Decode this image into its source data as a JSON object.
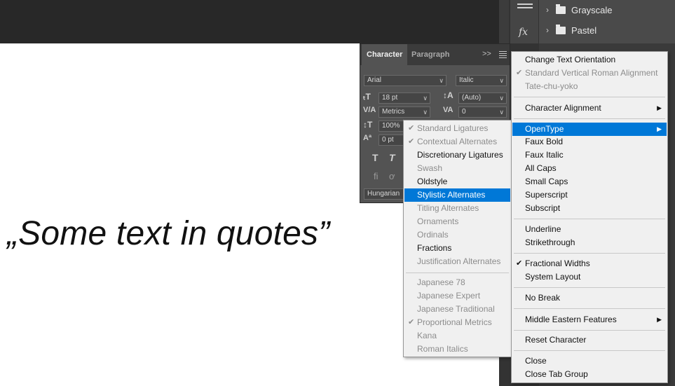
{
  "canvas": {
    "sample_text": "„Some text in quotes”"
  },
  "swatches": {
    "items": [
      "Grayscale",
      "Pastel"
    ]
  },
  "panel": {
    "tabs": [
      "Character",
      "Paragraph"
    ],
    "expand_glyph": ">>",
    "font_family": "Arial",
    "font_style": "Italic",
    "font_size": "18 pt",
    "leading": "(Auto)",
    "kerning": "Metrics",
    "tracking": "0",
    "vertical_scale": "100%",
    "baseline_shift": "0 pt",
    "language": "Hungarian"
  },
  "main_menu": {
    "items": [
      {
        "label": "Change Text Orientation",
        "checked": false,
        "disabled": false,
        "submenu": false
      },
      {
        "label": "Standard Vertical Roman Alignment",
        "checked": true,
        "disabled": true,
        "submenu": false
      },
      {
        "label": "Tate-chu-yoko",
        "checked": false,
        "disabled": true,
        "submenu": false
      },
      {
        "label": "Character Alignment",
        "checked": false,
        "disabled": false,
        "submenu": true
      },
      {
        "label": "OpenType",
        "checked": false,
        "disabled": false,
        "submenu": true,
        "selected": true
      },
      {
        "label": "Faux Bold",
        "checked": false,
        "disabled": false,
        "submenu": false
      },
      {
        "label": "Faux Italic",
        "checked": false,
        "disabled": false,
        "submenu": false
      },
      {
        "label": "All Caps",
        "checked": false,
        "disabled": false,
        "submenu": false
      },
      {
        "label": "Small Caps",
        "checked": false,
        "disabled": false,
        "submenu": false
      },
      {
        "label": "Superscript",
        "checked": false,
        "disabled": false,
        "submenu": false
      },
      {
        "label": "Subscript",
        "checked": false,
        "disabled": false,
        "submenu": false
      },
      {
        "label": "Underline",
        "checked": false,
        "disabled": false,
        "submenu": false
      },
      {
        "label": "Strikethrough",
        "checked": false,
        "disabled": false,
        "submenu": false
      },
      {
        "label": "Fractional Widths",
        "checked": true,
        "disabled": false,
        "submenu": false
      },
      {
        "label": "System Layout",
        "checked": false,
        "disabled": false,
        "submenu": false
      },
      {
        "label": "No Break",
        "checked": false,
        "disabled": false,
        "submenu": false
      },
      {
        "label": "Middle Eastern Features",
        "checked": false,
        "disabled": false,
        "submenu": true
      },
      {
        "label": "Reset Character",
        "checked": false,
        "disabled": false,
        "submenu": false
      },
      {
        "label": "Close",
        "checked": false,
        "disabled": false,
        "submenu": false
      },
      {
        "label": "Close Tab Group",
        "checked": false,
        "disabled": false,
        "submenu": false
      }
    ]
  },
  "opentype_menu": {
    "items": [
      {
        "label": "Standard Ligatures",
        "checked": true,
        "disabled": true
      },
      {
        "label": "Contextual Alternates",
        "checked": true,
        "disabled": true
      },
      {
        "label": "Discretionary Ligatures",
        "checked": false,
        "disabled": false
      },
      {
        "label": "Swash",
        "checked": false,
        "disabled": true
      },
      {
        "label": "Oldstyle",
        "checked": false,
        "disabled": false
      },
      {
        "label": "Stylistic Alternates",
        "checked": false,
        "disabled": false,
        "selected": true
      },
      {
        "label": "Titling Alternates",
        "checked": false,
        "disabled": true
      },
      {
        "label": "Ornaments",
        "checked": false,
        "disabled": true
      },
      {
        "label": "Ordinals",
        "checked": false,
        "disabled": true
      },
      {
        "label": "Fractions",
        "checked": false,
        "disabled": false
      },
      {
        "label": "Justification Alternates",
        "checked": false,
        "disabled": true
      },
      {
        "label": "Japanese 78",
        "checked": false,
        "disabled": true
      },
      {
        "label": "Japanese Expert",
        "checked": false,
        "disabled": true
      },
      {
        "label": "Japanese Traditional",
        "checked": false,
        "disabled": true
      },
      {
        "label": "Proportional Metrics",
        "checked": true,
        "disabled": true
      },
      {
        "label": "Kana",
        "checked": false,
        "disabled": true
      },
      {
        "label": "Roman Italics",
        "checked": false,
        "disabled": true
      }
    ]
  },
  "colors": {
    "selection": "#0078d7",
    "menu_bg": "#f0f0f0",
    "panel_bg": "#535353"
  }
}
